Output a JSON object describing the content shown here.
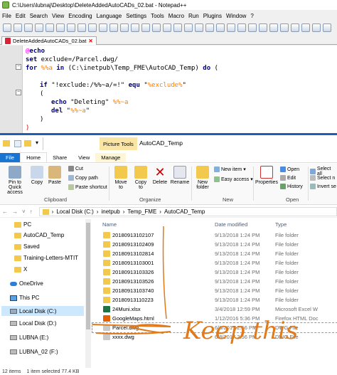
{
  "npp": {
    "title": "C:\\Users\\lubnaj\\Desktop\\DeleteAddedAutoCADs_02.bat - Notepad++",
    "menu": [
      "File",
      "Edit",
      "Search",
      "View",
      "Encoding",
      "Language",
      "Settings",
      "Tools",
      "Macro",
      "Run",
      "Plugins",
      "Window",
      "?"
    ],
    "tab": "DeleteAddedAutoCADs_02.bat",
    "lines": {
      "l1a": "@",
      "l1b": "echo",
      "l2a": "set",
      "l2b": " exclude=/Parcel.dwg/",
      "l3a": "for",
      "l3b": " %%a ",
      "l3c": "in",
      "l3d": " (C:\\inetpub\\Temp_FME\\AutoCAD_Temp) ",
      "l3e": "do",
      "l3f": " (",
      "l5a": "if",
      "l5b": " \"!exclude:/%%~a/=!\" ",
      "l5c": "equ",
      "l5d": " \"",
      "l5e": "%exclude%",
      "l5f": "\"",
      "l6": "(",
      "l7a": "echo",
      "l7b": " \"Deleting\" ",
      "l7c": "%%~a",
      "l8a": "del",
      "l8b": " \"",
      "l8c": "%%~a",
      "l8d": "\"",
      "l9": ")",
      "l10": ")"
    }
  },
  "explorer": {
    "picture_tools": "Picture Tools",
    "title": "AutoCAD_Temp",
    "tabs": [
      "File",
      "Home",
      "Share",
      "View",
      "Manage"
    ],
    "ribbon": {
      "pin": "Pin to Quick access",
      "copy": "Copy",
      "paste": "Paste",
      "cut": "Cut",
      "copy_path": "Copy path",
      "paste_shortcut": "Paste shortcut",
      "move_to": "Move to",
      "copy_to": "Copy to",
      "delete": "Delete",
      "rename": "Rename",
      "new_folder": "New folder",
      "new_item": "New item",
      "easy_access": "Easy access",
      "properties": "Properties",
      "open": "Open",
      "edit": "Edit",
      "history": "History",
      "select_all": "Select all",
      "select_none": "Select n",
      "invert": "Invert se",
      "g_clipboard": "Clipboard",
      "g_organize": "Organize",
      "g_new": "New",
      "g_open": "Open"
    },
    "path": [
      "Local Disk (C:)",
      "inetpub",
      "Temp_FME",
      "AutoCAD_Temp"
    ],
    "nav": [
      {
        "label": "PC",
        "icon": "folder"
      },
      {
        "label": "AutoCAD_Temp",
        "icon": "folder"
      },
      {
        "label": "Saved",
        "icon": "folder"
      },
      {
        "label": "Training-Letters-MTIT",
        "icon": "folder"
      },
      {
        "label": "X",
        "icon": "folder"
      },
      {
        "label": "OneDrive",
        "icon": "cloud"
      },
      {
        "label": "This PC",
        "icon": "pc"
      },
      {
        "label": "Local Disk (C:)",
        "icon": "drive"
      },
      {
        "label": "Local Disk (D:)",
        "icon": "drive"
      },
      {
        "label": "LUBNA (E:)",
        "icon": "drive"
      },
      {
        "label": "LUBNA_02 (F:)",
        "icon": "drive"
      }
    ],
    "columns": {
      "name": "Name",
      "date": "Date modified",
      "type": "Type"
    },
    "files": [
      {
        "name": "20180913102107",
        "date": "9/13/2018 1:24 PM",
        "type": "File folder",
        "icon": "folder"
      },
      {
        "name": "20180913102409",
        "date": "9/13/2018 1:24 PM",
        "type": "File folder",
        "icon": "folder"
      },
      {
        "name": "20180913102814",
        "date": "9/13/2018 1:24 PM",
        "type": "File folder",
        "icon": "folder"
      },
      {
        "name": "20180913103001",
        "date": "9/13/2018 1:24 PM",
        "type": "File folder",
        "icon": "folder"
      },
      {
        "name": "20180913103326",
        "date": "9/13/2018 1:24 PM",
        "type": "File folder",
        "icon": "folder"
      },
      {
        "name": "20180913103526",
        "date": "9/13/2018 1:24 PM",
        "type": "File folder",
        "icon": "folder"
      },
      {
        "name": "20180913103740",
        "date": "9/13/2018 1:24 PM",
        "type": "File folder",
        "icon": "folder"
      },
      {
        "name": "20180913110223",
        "date": "9/13/2018 1:24 PM",
        "type": "File folder",
        "icon": "folder"
      },
      {
        "name": "24Muni.xlsx",
        "date": "3/4/2018 12:59 PM",
        "type": "Microsoft Excel W",
        "icon": "excel"
      },
      {
        "name": "GoogleMaps.html",
        "date": "1/12/2016 5:36 PM",
        "type": "Firefox HTML Doc",
        "icon": "html"
      },
      {
        "name": "Parcel.dwg",
        "date": "6/8/2017 2:56 PM",
        "type": "DWG File",
        "icon": "dwg"
      },
      {
        "name": "xxxx.dwg",
        "date": "6/8/2017 2:56 PM",
        "type": "DWG File",
        "icon": "dwg"
      }
    ],
    "status": {
      "count": "12 items",
      "selected": "1 item selected  77.4 KB"
    },
    "annotation": "Keep this"
  },
  "colors": {
    "annotation": "#e07a1a",
    "accent": "#1a74d1"
  }
}
